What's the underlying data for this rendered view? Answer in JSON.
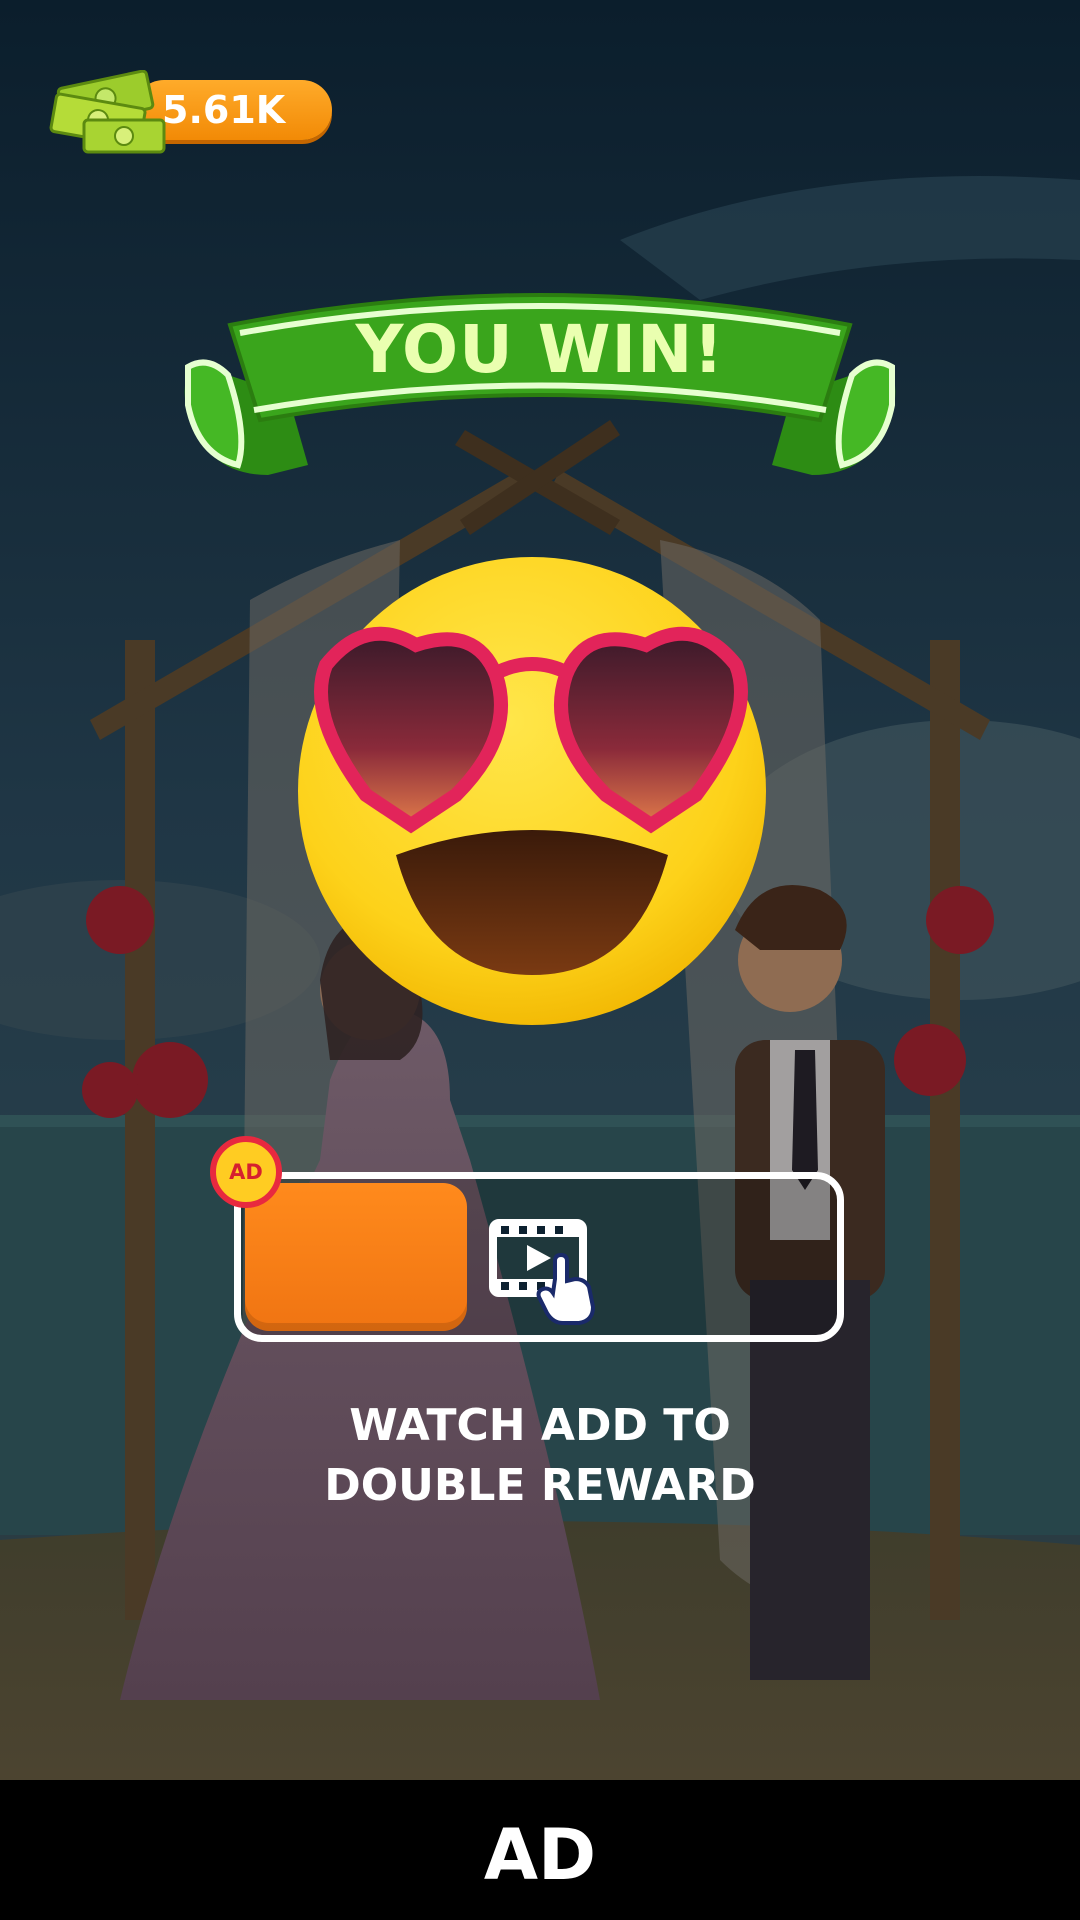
{
  "currency": {
    "amount": "5.61K",
    "icon": "cash-stack-icon"
  },
  "banner": {
    "title": "YOU WIN!"
  },
  "emoji": {
    "icon": "heart-sunglasses-smiley-icon"
  },
  "reward": {
    "badge_label": "AD",
    "video_icon": "video-tap-icon",
    "caption_line1": "WATCH ADD TO",
    "caption_line2": "DOUBLE REWARD"
  },
  "ad_bar": {
    "label": "AD"
  },
  "colors": {
    "banner_green": "#3aa51c",
    "button_orange": "#f47a14",
    "currency_orange": "#f59312",
    "badge_red": "#e8293f",
    "badge_yellow": "#ffcc22"
  }
}
